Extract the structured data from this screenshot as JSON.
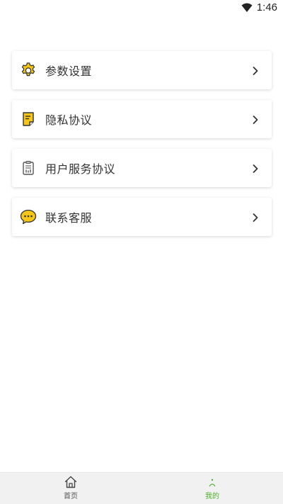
{
  "status_bar": {
    "time": "1:46"
  },
  "menu": {
    "items": [
      {
        "label": "参数设置",
        "icon": "gear-icon"
      },
      {
        "label": "隐私协议",
        "icon": "document-icon"
      },
      {
        "label": "用户服务协议",
        "icon": "clipboard-icon"
      },
      {
        "label": "联系客服",
        "icon": "chat-bubble-icon"
      }
    ]
  },
  "bottom_nav": {
    "home_label": "首页",
    "mine_label": "我的",
    "active": "mine"
  },
  "colors": {
    "accent_yellow": "#f5c518",
    "accent_green": "#4caf2a"
  }
}
